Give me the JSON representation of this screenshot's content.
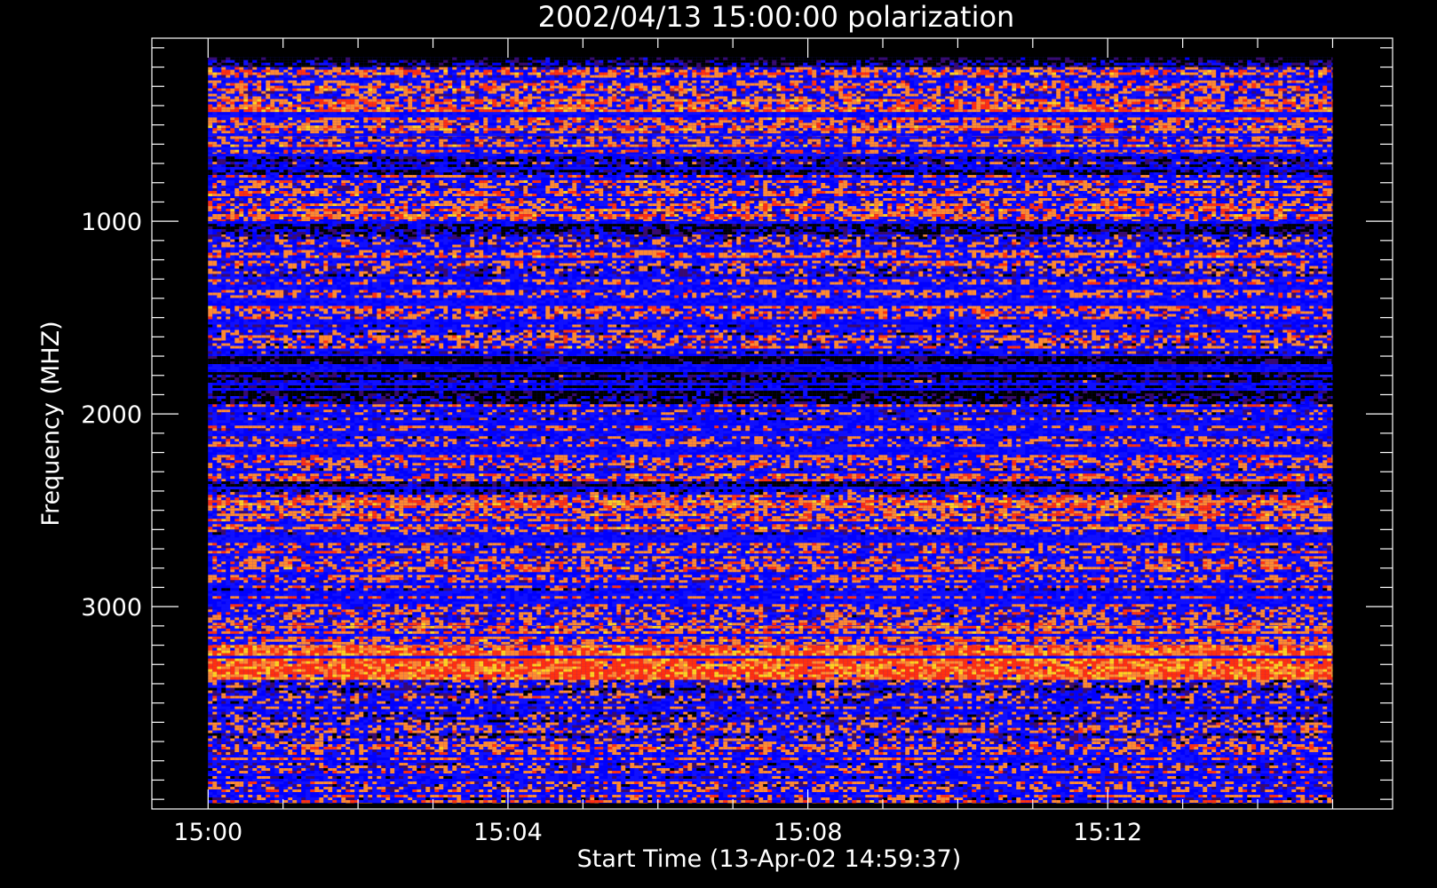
{
  "chart_data": {
    "type": "heatmap",
    "title": "2002/04/13 15:00:00 polarization",
    "xlabel": "Start Time (13-Apr-02 14:59:37)",
    "ylabel": "Frequency (MHZ)",
    "x_tick_labels": [
      "15:00",
      "15:04",
      "15:08",
      "15:12"
    ],
    "x_ticks_minutes": [
      0,
      4,
      8,
      12
    ],
    "xlim_minutes": [
      -0.75,
      15.8
    ],
    "data_x_range_minutes": [
      0,
      15
    ],
    "y_tick_labels": [
      "1000",
      "2000",
      "3000"
    ],
    "y_ticks": [
      1000,
      2000,
      3000
    ],
    "ylim": [
      4050,
      50
    ],
    "data_y_range": [
      150,
      4020
    ],
    "y_axis_inverted": true,
    "grid": false,
    "colormap": [
      "#000000",
      "#3a0a6e",
      "#1010ff",
      "#0000ff",
      "#ff3010",
      "#ff8a30",
      "#ffd020"
    ],
    "colors": {
      "background": "#000000",
      "axis": "#ffffff"
    },
    "bands": [
      {
        "y0": 150,
        "y1": 200,
        "v": 0.1
      },
      {
        "y0": 200,
        "y1": 420,
        "v": 0.55
      },
      {
        "y0": 420,
        "y1": 560,
        "v": 0.6
      },
      {
        "y0": 560,
        "y1": 650,
        "v": 0.5
      },
      {
        "y0": 650,
        "y1": 760,
        "v": 0.25
      },
      {
        "y0": 760,
        "y1": 880,
        "v": 0.5
      },
      {
        "y0": 880,
        "y1": 1000,
        "v": 0.55
      },
      {
        "y0": 1000,
        "y1": 1080,
        "v": 0.2
      },
      {
        "y0": 1080,
        "y1": 1700,
        "v": 0.45
      },
      {
        "y0": 1700,
        "y1": 1950,
        "v": 0.1
      },
      {
        "y0": 1950,
        "y1": 2350,
        "v": 0.45
      },
      {
        "y0": 2350,
        "y1": 2420,
        "v": 0.15
      },
      {
        "y0": 2420,
        "y1": 2600,
        "v": 0.6
      },
      {
        "y0": 2600,
        "y1": 3100,
        "v": 0.45
      },
      {
        "y0": 3100,
        "y1": 3200,
        "v": 0.55
      },
      {
        "y0": 3200,
        "y1": 3380,
        "v": 0.82
      },
      {
        "y0": 3380,
        "y1": 3700,
        "v": 0.35
      },
      {
        "y0": 3700,
        "y1": 4020,
        "v": 0.45
      }
    ]
  }
}
